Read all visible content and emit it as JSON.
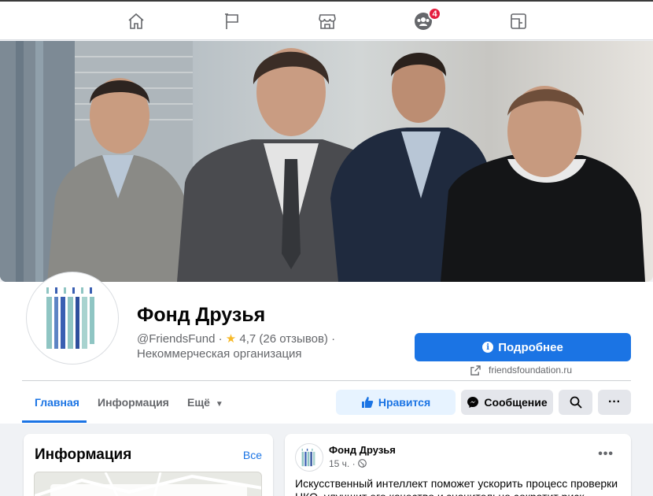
{
  "nav": {
    "items": [
      {
        "icon": "home-icon"
      },
      {
        "icon": "pages-flag-icon"
      },
      {
        "icon": "marketplace-icon"
      },
      {
        "icon": "groups-icon",
        "badge": "4"
      },
      {
        "icon": "gaming-icon"
      }
    ]
  },
  "cover": {
    "description": "cover-photo"
  },
  "profile": {
    "name": "Фонд Друзья",
    "handle": "@FriendsFund",
    "rating_separator": " · ",
    "rating": "4,7 (26 отзывов)",
    "trailing_dot": " ·",
    "category": "Некоммерческая организация",
    "details_button": "Подробнее",
    "website": "friendsfoundation.ru"
  },
  "tabs": [
    {
      "label": "Главная",
      "active": true
    },
    {
      "label": "Информация",
      "active": false
    },
    {
      "label": "Ещё",
      "active": false
    }
  ],
  "actions": {
    "like": "Нравится",
    "message": "Сообщение",
    "more": "···"
  },
  "info_card": {
    "title": "Информация",
    "see_all": "Все"
  },
  "post": {
    "author": "Фонд Друзья",
    "time": "15 ч. ·",
    "more": "•••",
    "text": "Искусственный интеллект поможет ускорить процесс проверки НКО, улучшит его качество и значительно сократит риск"
  },
  "colors": {
    "accent": "#1b74e4",
    "badge": "#e41e3f",
    "logo_teal": "#8fc5c3",
    "logo_blue": "#3a5fb2"
  }
}
